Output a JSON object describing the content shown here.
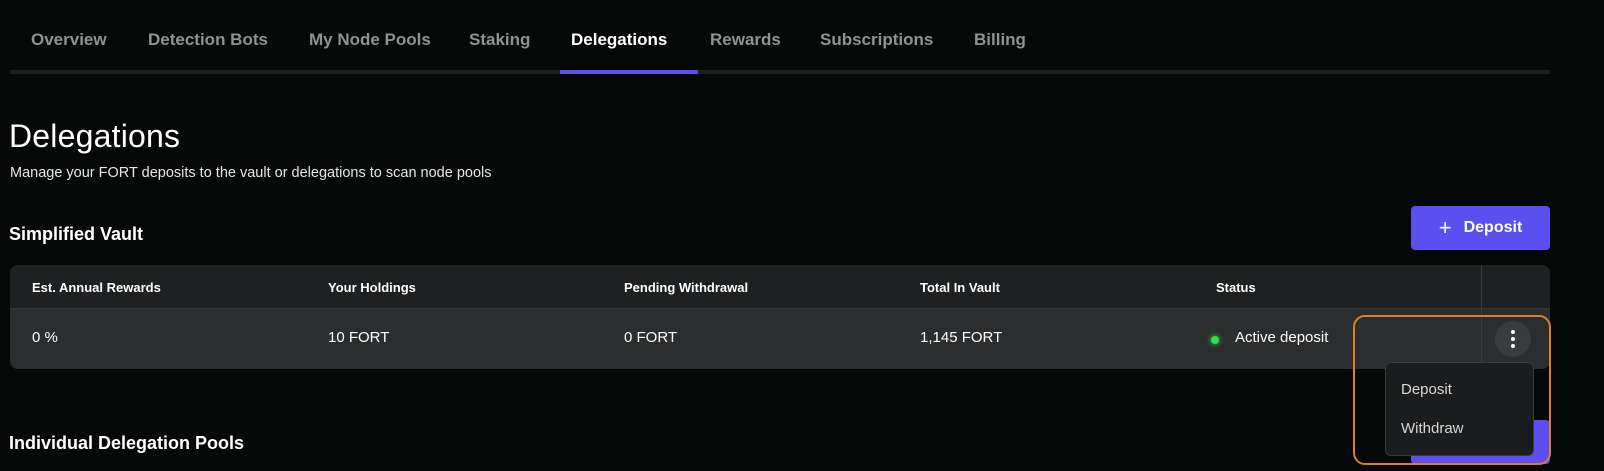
{
  "tabs": [
    {
      "label": "Overview",
      "active": false
    },
    {
      "label": "Detection Bots",
      "active": false
    },
    {
      "label": "My Node Pools",
      "active": false
    },
    {
      "label": "Staking",
      "active": false
    },
    {
      "label": "Delegations",
      "active": true
    },
    {
      "label": "Rewards",
      "active": false
    },
    {
      "label": "Subscriptions",
      "active": false
    },
    {
      "label": "Billing",
      "active": false
    }
  ],
  "page": {
    "title": "Delegations",
    "subtitle": "Manage your FORT deposits to the vault or delegations to scan node pools"
  },
  "vault": {
    "title": "Simplified Vault",
    "deposit_button": "Deposit",
    "columns": [
      "Est. Annual Rewards",
      "Your Holdings",
      "Pending Withdrawal",
      "Total In Vault",
      "Status"
    ],
    "row": {
      "est_annual_rewards": "0 %",
      "your_holdings": "10 FORT",
      "pending_withdrawal": "0 FORT",
      "total_in_vault": "1,145 FORT",
      "status": "Active deposit"
    }
  },
  "menu": {
    "items": [
      "Deposit",
      "Withdraw"
    ]
  },
  "individual": {
    "title": "Individual Delegation Pools"
  },
  "colors": {
    "accent": "#5b4ff0",
    "status_active": "#2ee04a",
    "highlight": "#d9822b"
  },
  "icons": {
    "deposit_button": "plus-icon",
    "row_actions": "more-vertical-icon",
    "status": "status-dot-icon"
  }
}
